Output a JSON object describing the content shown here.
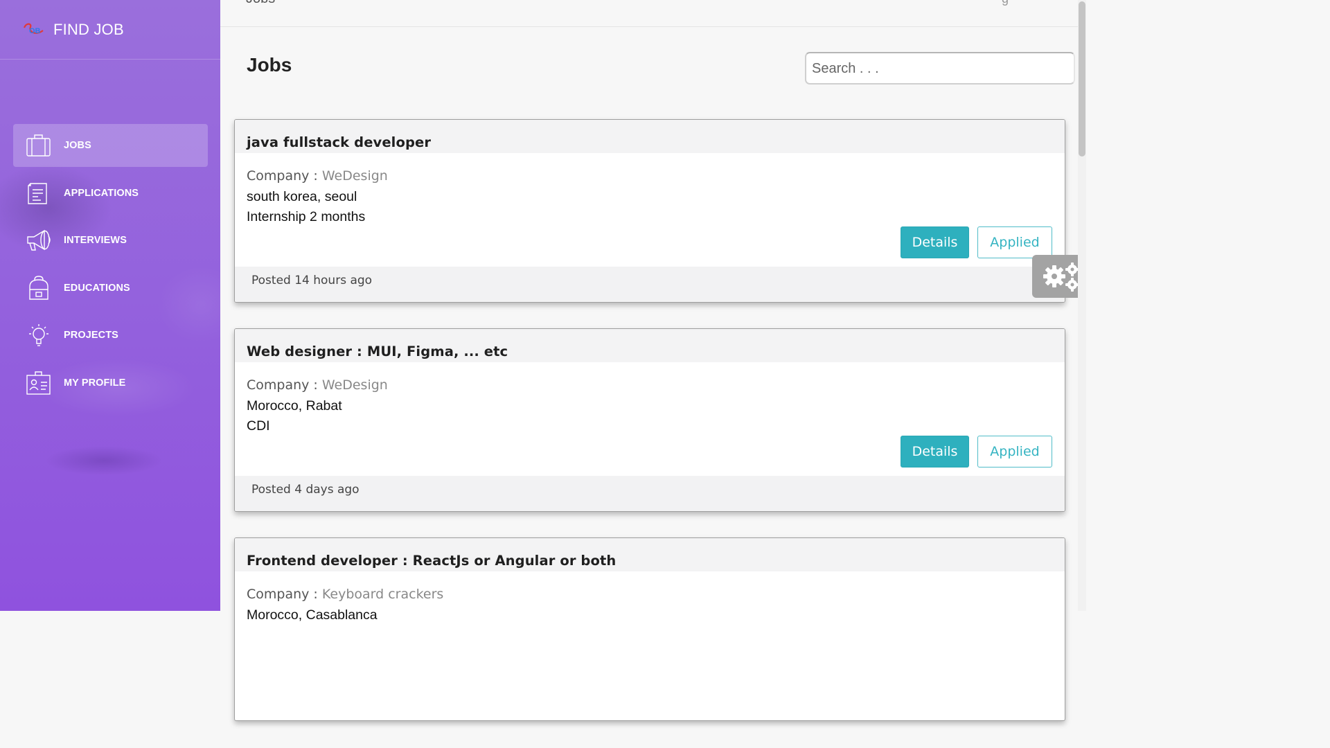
{
  "brand": {
    "title": "FIND JOB",
    "logo_text": "OB"
  },
  "topbar": {
    "crumb": "Jobs",
    "user_hint": "g"
  },
  "sidebar": {
    "items": [
      {
        "label": "JOBS",
        "icon": "briefcase-icon",
        "active": true
      },
      {
        "label": "APPLICATIONS",
        "icon": "document-icon",
        "active": false
      },
      {
        "label": "INTERVIEWS",
        "icon": "megaphone-icon",
        "active": false
      },
      {
        "label": "EDUCATIONS",
        "icon": "backpack-icon",
        "active": false
      },
      {
        "label": "PROJECTS",
        "icon": "lightbulb-icon",
        "active": false
      },
      {
        "label": "MY PROFILE",
        "icon": "id-card-icon",
        "active": false
      }
    ]
  },
  "main": {
    "title": "Jobs",
    "search_placeholder": "Search . . .",
    "company_label": "Company : ",
    "details_label": "Details",
    "applied_label": "Applied",
    "jobs": [
      {
        "title": "java fullstack developer",
        "company": "WeDesign",
        "location": "south korea, seoul",
        "contract": "Internship 2 months",
        "posted": "Posted 14 hours ago"
      },
      {
        "title": "Web designer : MUI, Figma, ... etc",
        "company": "WeDesign",
        "location": "Morocco, Rabat",
        "contract": "CDI",
        "posted": "Posted 4 days ago"
      },
      {
        "title": "Frontend developer : ReactJs or Angular or both",
        "company": "Keyboard crackers",
        "location": "Morocco, Casablanca",
        "contract": "",
        "posted": ""
      }
    ]
  },
  "colors": {
    "sidebar_top": "#9a6fdc",
    "sidebar_bottom": "#8f52de",
    "accent": "#2eb0be",
    "settings_tab": "#a3a3a3"
  }
}
